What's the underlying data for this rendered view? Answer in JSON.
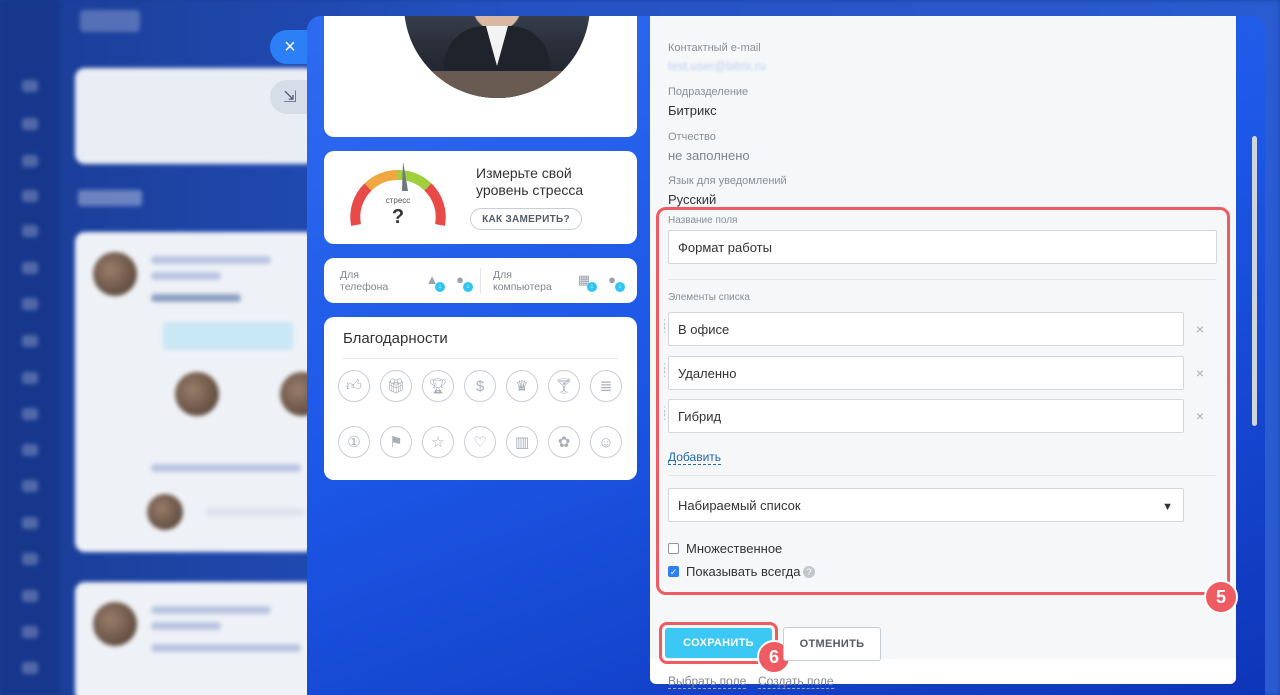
{
  "stress": {
    "gauge_label": "стресс",
    "gauge_value": "?",
    "title": "Измерьте свой уровень стресса",
    "button": "КАК ЗАМЕРИТЬ?"
  },
  "apps": {
    "phone_label": "Для телефона",
    "computer_label": "Для компьютера"
  },
  "thanks": {
    "title": "Благодарности"
  },
  "profile": {
    "email_label": "Контактный e-mail",
    "email_value": "test.user@bitrix.ru",
    "department_label": "Подразделение",
    "department_value": "Битрикс",
    "middle_name_label": "Отчество",
    "middle_name_value": "не заполнено",
    "language_label": "Язык для уведомлений",
    "language_value": "Русский"
  },
  "field_editor": {
    "name_label": "Название поля",
    "name_value": "Формат работы",
    "items_label": "Элементы списка",
    "items": [
      "В офисе",
      "Удаленно",
      "Гибрид"
    ],
    "add_link": "Добавить",
    "type_value": "Набираемый список",
    "multiple_label": "Множественное",
    "multiple_checked": false,
    "show_always_label": "Показывать всегда",
    "show_always_checked": true
  },
  "actions": {
    "save": "СОХРАНИТЬ",
    "cancel": "ОТМЕНИТЬ",
    "select_field": "Выбрать поле",
    "create_field": "Создать поле"
  },
  "steps": {
    "edit_step": "5",
    "save_step": "6"
  },
  "colors": {
    "accent": "#2d7ff7",
    "highlight": "#ef5b62",
    "save": "#3bc8f5"
  }
}
